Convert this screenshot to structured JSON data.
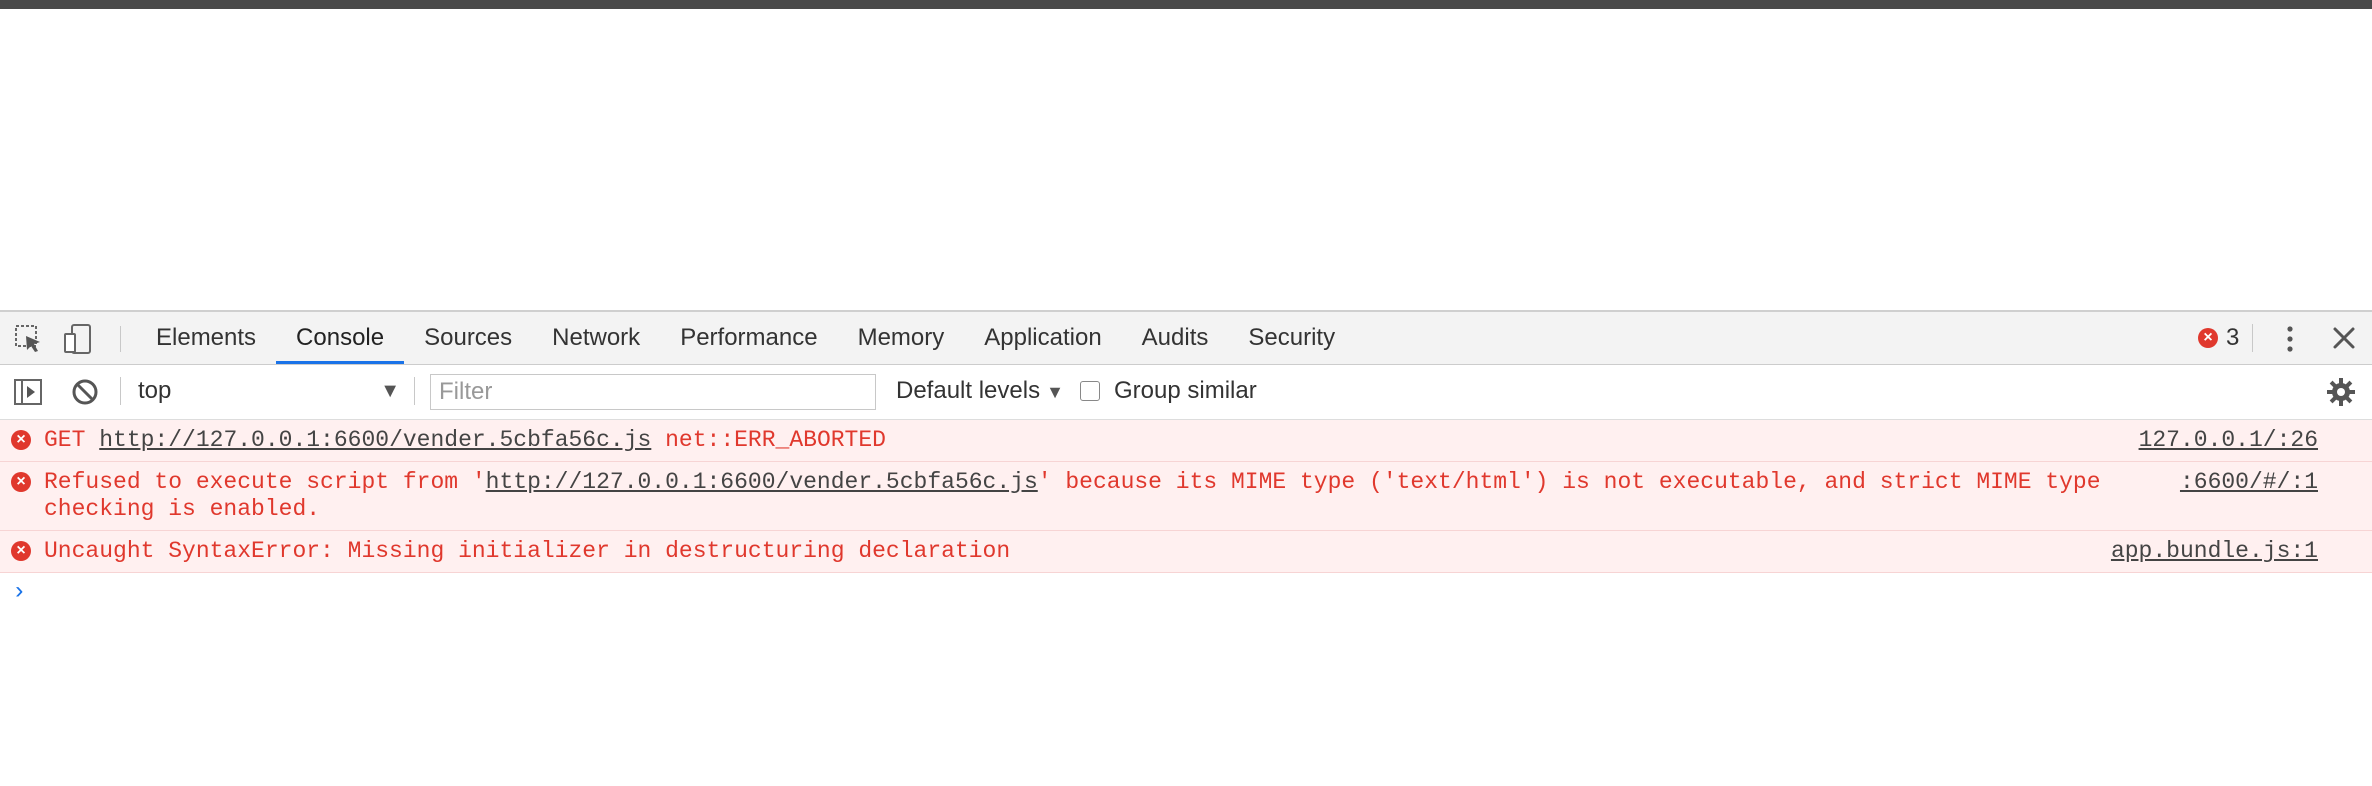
{
  "devtools": {
    "tabs": [
      "Elements",
      "Console",
      "Sources",
      "Network",
      "Performance",
      "Memory",
      "Application",
      "Audits",
      "Security"
    ],
    "active_tab": "Console",
    "error_count": "3",
    "error_badge_glyph": "×"
  },
  "console_toolbar": {
    "context": "top",
    "filter_placeholder": "Filter",
    "levels_label": "Default levels",
    "group_similar_label": "Group similar"
  },
  "messages": [
    {
      "prefix": "GET ",
      "url": "http://127.0.0.1:6600/vender.5cbfa56c.js",
      "suffix": " net::ERR_ABORTED",
      "source": "127.0.0.1/:26"
    },
    {
      "prefix": "Refused to execute script from '",
      "url": "http://127.0.0.1:6600/vender.5cbfa56c.js",
      "suffix": "' because its MIME type ('text/html') is not executable, and strict MIME type checking is enabled.",
      "source": ":6600/#/:1"
    },
    {
      "prefix": "Uncaught SyntaxError: Missing initializer in destructuring declaration",
      "url": "",
      "suffix": "",
      "source": "app.bundle.js:1"
    }
  ],
  "prompt_glyph": "›",
  "colors": {
    "error_red": "#e0382d",
    "active_tab_blue": "#1a73e8",
    "error_row_bg": "#fff0f0"
  }
}
